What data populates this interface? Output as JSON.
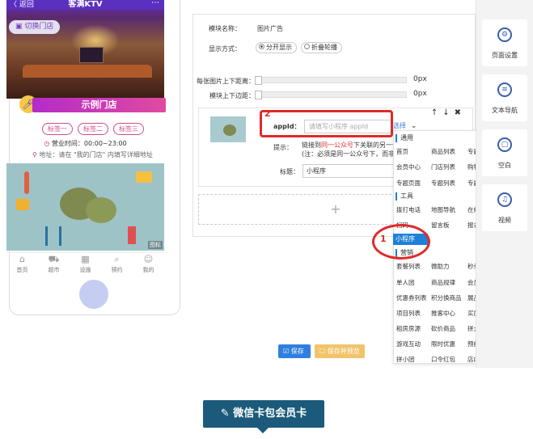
{
  "phone": {
    "back_label": "〈 返回",
    "title": "客满KTV",
    "switch_store": "切换门店",
    "store_name": "示例门店",
    "tags": [
      "标签一",
      "标签二",
      "标签三"
    ],
    "hours": "营业时间：00:00~23:00",
    "address": "地址：请在 \"我的门店\" 内填写详细地址",
    "image_watermark": "图标",
    "tabbar": [
      {
        "label": "首页",
        "icon": "home-icon",
        "glyph": "⌂"
      },
      {
        "label": "超市",
        "icon": "cart-icon",
        "glyph": "⛟"
      },
      {
        "label": "设施",
        "icon": "grid-icon",
        "glyph": "▦"
      },
      {
        "label": "预约",
        "icon": "search-icon",
        "glyph": "⌕"
      },
      {
        "label": "我的",
        "icon": "user-icon",
        "glyph": "☺"
      }
    ]
  },
  "editor": {
    "module_name_label": "模块名称：",
    "module_name_value": "图片广告",
    "display_mode_label": "显示方式：",
    "display_options": [
      {
        "label": "分开显示",
        "selected": true
      },
      {
        "label": "折叠轮播",
        "selected": false
      }
    ],
    "margin_vertical_label": "每张图片上下距离：",
    "margin_vertical_value": "0px",
    "module_margin_label": "模块上下边距：",
    "module_margin_value": "0px",
    "item": {
      "tools": "✚ ✚ ✖",
      "appid_label": "appId：",
      "appid_placeholder": "请填写小程序 appId",
      "choose_link": "选择",
      "hint_label": "提示：",
      "hint_line1_prefix": "链接到",
      "hint_line1_red": "同一公众号",
      "hint_line1_suffix": "下关联的另一个小",
      "hint_line2": "(注：必须是同一公众号下，而非同个",
      "title_label": "标题：",
      "title_value": "小程序"
    },
    "add_symbol": "+"
  },
  "annotations": {
    "num1": "1",
    "num2": "2"
  },
  "dropdown": {
    "groups": [
      {
        "label": "通用",
        "top": 0
      },
      {
        "label": "工具",
        "top": 0
      },
      {
        "label": "营销",
        "top": 0
      }
    ],
    "rows": [
      [
        "首页",
        "商品列表",
        "专题分类"
      ],
      [
        "会员中心",
        "门店列表",
        "购物车"
      ],
      [
        "专题页面",
        "专题列表",
        "专题发布"
      ],
      [
        "拨打电话",
        "地图导航",
        "在线买单"
      ],
      [
        "扫码",
        "留言板",
        "报名预约"
      ],
      [
        "小程序"
      ],
      [
        "套餐列表",
        "微助力",
        "秒杀商品"
      ],
      [
        "单人团",
        "商品规律",
        "会员充值"
      ],
      [
        "优惠券列表",
        "积分换商品",
        "展品列表"
      ],
      [
        "项目列表",
        "推客中心",
        "买房房源"
      ],
      [
        "租房房源",
        "砍价商品",
        "拼大团"
      ],
      [
        "游戏互动",
        "限时优惠",
        "预约项目"
      ],
      [
        "拼小团",
        "口令红包",
        "店内套餐"
      ]
    ],
    "selected": "小程序"
  },
  "sidebar": {
    "items": [
      {
        "label": "页面设置",
        "icon": "gear-icon",
        "glyph": "⚙"
      },
      {
        "label": "文本导航",
        "icon": "list-icon",
        "glyph": "≡"
      },
      {
        "label": "空白",
        "icon": "blank-icon",
        "glyph": "▢"
      },
      {
        "label": "视频",
        "icon": "music-icon",
        "glyph": "♫"
      }
    ]
  },
  "buttons": {
    "save": "保存",
    "save_preview": "保存并预览"
  },
  "banner": {
    "text": "微信卡包会员卡"
  }
}
